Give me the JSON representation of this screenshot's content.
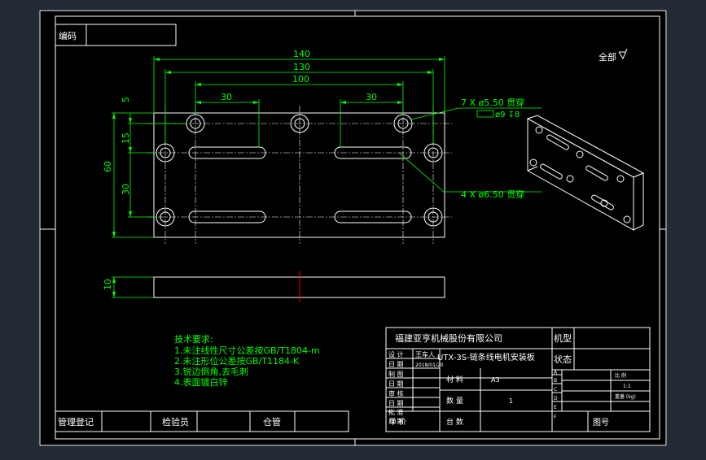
{
  "colors": {
    "background": "#222a33",
    "sheet": "#000000",
    "frame": "#ffffff",
    "dimension": "#00ff00",
    "part": "#ffffff",
    "centerline": "#ff0000"
  },
  "top_block": {
    "code_label": "编码"
  },
  "surface": {
    "label": "全部"
  },
  "dimensions": {
    "d140": "140",
    "d130": "130",
    "d100": "100",
    "d30_left": "30",
    "d30_right": "30",
    "d5": "5",
    "d15": "15",
    "d60": "60",
    "d30_vertical": "30",
    "d10": "10"
  },
  "callouts": {
    "hole_a": "7 X ø5.50 贯穿",
    "hole_a_counterbore": "ø9 ↧8",
    "hole_b": "4 X ø6.50 贯穿"
  },
  "notes": {
    "title": "技术要求:",
    "lines": [
      "1.未注线性尺寸公差按GB/T1804-m",
      "2.未注形位公差按GB/T1184-K",
      "3.锐边倒角,去毛刺",
      "4.表面镀白锌"
    ]
  },
  "title_block": {
    "company": "福建亚亨机械股份有限公司",
    "part_name": "UTX-3S-链条线电机安装板",
    "machine_label": "机型",
    "status_label": "状态",
    "design_label": "设 计",
    "designer": "王车人",
    "date_label": "日 期",
    "design_date": "2018/01/20",
    "drawing_label": "制 图",
    "date2_label": "日 期",
    "check_label": "审 核",
    "date3_label": "日 期",
    "approve_label": "批 准",
    "date4_label": "日 期",
    "unit_label": "单 价",
    "material_label": "材 料",
    "material": "A3",
    "qty_label": "数 量",
    "qty": "1",
    "sets_label": "台 数",
    "drawing_no_label": "图号",
    "scale_label": "比 例",
    "scale": "1:1",
    "weight_label": "重量 (kg)",
    "state_rows": [
      "A",
      "B",
      "C",
      "D",
      "E",
      "F"
    ]
  },
  "bottom_block": {
    "registry": "管理登记",
    "inspector": "检验员",
    "storage": "仓管"
  }
}
